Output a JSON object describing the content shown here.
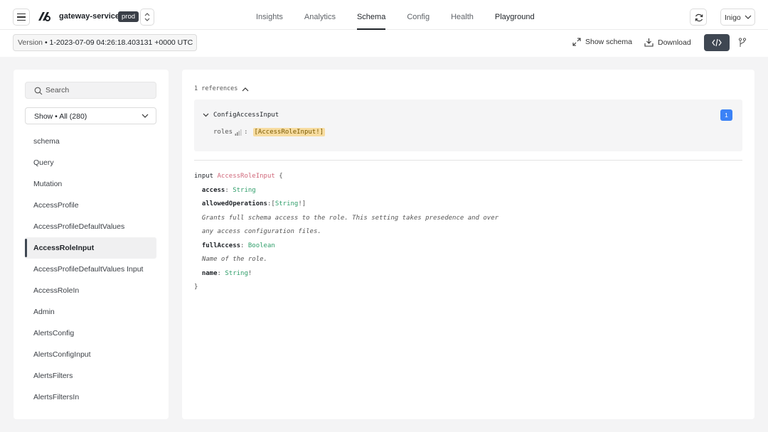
{
  "header": {
    "service_name": "gateway-service",
    "environment": "prod",
    "nav": [
      {
        "label": "Insights"
      },
      {
        "label": "Analytics"
      },
      {
        "label": "Schema"
      },
      {
        "label": "Config"
      },
      {
        "label": "Health"
      },
      {
        "label": "Playground"
      }
    ],
    "active_nav": "Schema",
    "user": "Inigo",
    "icons": {
      "menu": "hamburger-icon",
      "logo": "inigo-logo",
      "switch": "chevron-updown-icon",
      "refresh": "refresh-icon",
      "user_dropdown": "chevron-down-icon"
    }
  },
  "toolbar": {
    "version_prefix": "Version",
    "version_value": "1-2023-07-09 04:26:18.403131 +0000 UTC",
    "show_schema_label": "Show schema",
    "download_label": "Download",
    "icons": {
      "show_schema": "expand-icon",
      "download": "download-icon",
      "code_view": "code-icon",
      "branch": "branch-icon"
    }
  },
  "sidebar": {
    "search_placeholder": "Search",
    "filter_label": "Show • All (280)",
    "selected": "AccessRoleInput",
    "items": [
      {
        "label": "schema"
      },
      {
        "label": "Query"
      },
      {
        "label": "Mutation"
      },
      {
        "label": "AccessProfile"
      },
      {
        "label": "AccessProfileDefaultValues"
      },
      {
        "label": "AccessRoleInput"
      },
      {
        "label": "AccessProfileDefaultValues Input"
      },
      {
        "label": "AccessRoleIn"
      },
      {
        "label": "Admin"
      },
      {
        "label": "AlertsConfig"
      },
      {
        "label": "AlertsConfigInput"
      },
      {
        "label": "AlertsFilters"
      },
      {
        "label": "AlertsFiltersIn"
      }
    ]
  },
  "references": {
    "toggle_label": "1 references",
    "items": [
      {
        "type_name": "ConfigAccessInput",
        "field": "roles",
        "separator": ":",
        "field_type": "[AccessRoleInput!]",
        "count": "1"
      }
    ]
  },
  "sdl": {
    "keyword": "input",
    "type_name": "AccessRoleInput",
    "open_brace": "{",
    "close_brace": "}",
    "fields": [
      {
        "name": "access",
        "sep": ": ",
        "type": "String",
        "suffix": "",
        "prefix": ""
      },
      {
        "name": "allowedOperations",
        "sep": ":",
        "prefix": "[",
        "type": "String",
        "suffix": "!]"
      }
    ],
    "full_access_desc_1": "Grants full schema access to the role. This setting takes presedence and over",
    "full_access_desc_2": "any access configuration files.",
    "full_access": {
      "name": "fullAccess",
      "sep": ": ",
      "type": "Boolean"
    },
    "name_desc": "Name of the role.",
    "name_field": {
      "name": "name",
      "sep": ": ",
      "type": "String",
      "suffix": "!"
    }
  }
}
